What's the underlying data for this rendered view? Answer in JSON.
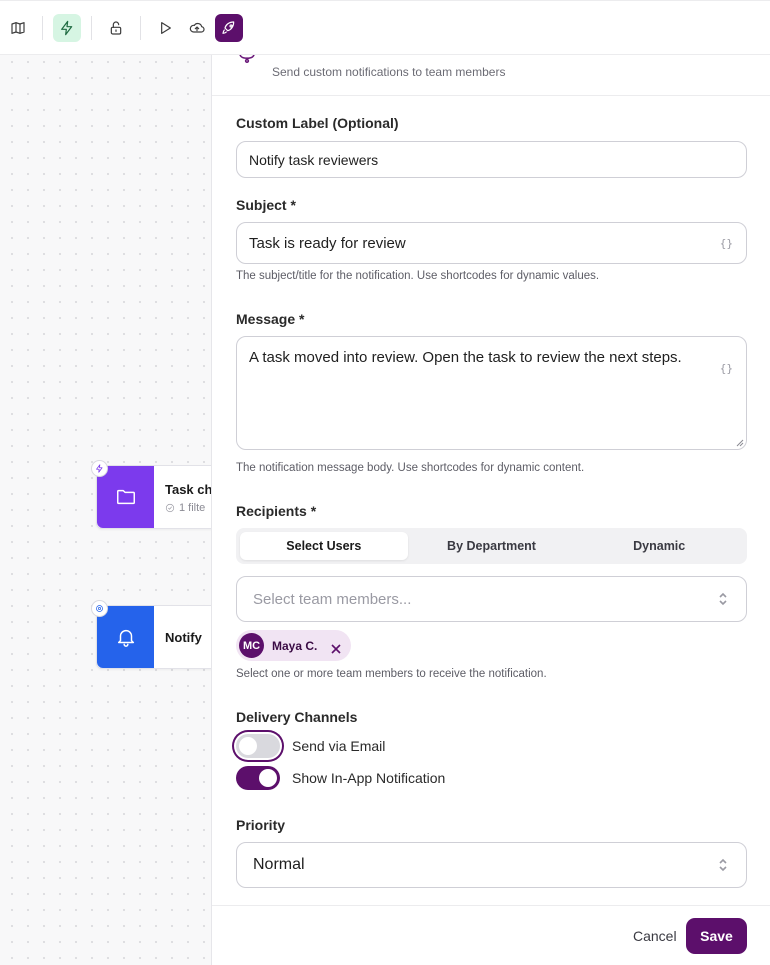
{
  "toolbar": {
    "buttons": [
      "map-icon",
      "lightning-icon",
      "unlock-icon",
      "play-icon",
      "cloud-upload-icon",
      "rocket-icon"
    ]
  },
  "canvas": {
    "nodes": [
      {
        "title": "Task ch",
        "sub": "1 filte",
        "color": "#7c3aed",
        "icon": "folder-icon",
        "badge": "lightning-icon"
      },
      {
        "title": "Notify",
        "sub": "",
        "color": "#2563eb",
        "icon": "bell-icon",
        "badge": "gear-icon"
      }
    ]
  },
  "panel": {
    "header_desc": "Send custom notifications to team members",
    "custom_label": {
      "label": "Custom Label (Optional)",
      "value": "Notify task reviewers"
    },
    "subject": {
      "label": "Subject *",
      "value": "Task is ready for review",
      "shortcode": "{}",
      "help": "The subject/title for the notification. Use shortcodes for dynamic values."
    },
    "message": {
      "label": "Message *",
      "value": "A task moved into review. Open the task to review the next steps.",
      "shortcode": "{}",
      "help": "The notification message body. Use shortcodes for dynamic content."
    },
    "recipients": {
      "label": "Recipients *",
      "tabs": [
        "Select Users",
        "By Department",
        "Dynamic"
      ],
      "selected_tab": "Select Users",
      "placeholder": "Select team members...",
      "chips": [
        {
          "initials": "MC",
          "name": "Maya C."
        }
      ],
      "help": "Select one or more team members to receive the notification."
    },
    "delivery": {
      "label": "Delivery Channels",
      "email": {
        "label": "Send via Email",
        "on": false
      },
      "inapp": {
        "label": "Show In-App Notification",
        "on": true
      }
    },
    "priority": {
      "label": "Priority",
      "value": "Normal"
    },
    "footer": {
      "cancel": "Cancel",
      "save": "Save"
    }
  },
  "colors": {
    "accent": "#5c0f6b",
    "toolbar_active": "#d6f5e3"
  }
}
